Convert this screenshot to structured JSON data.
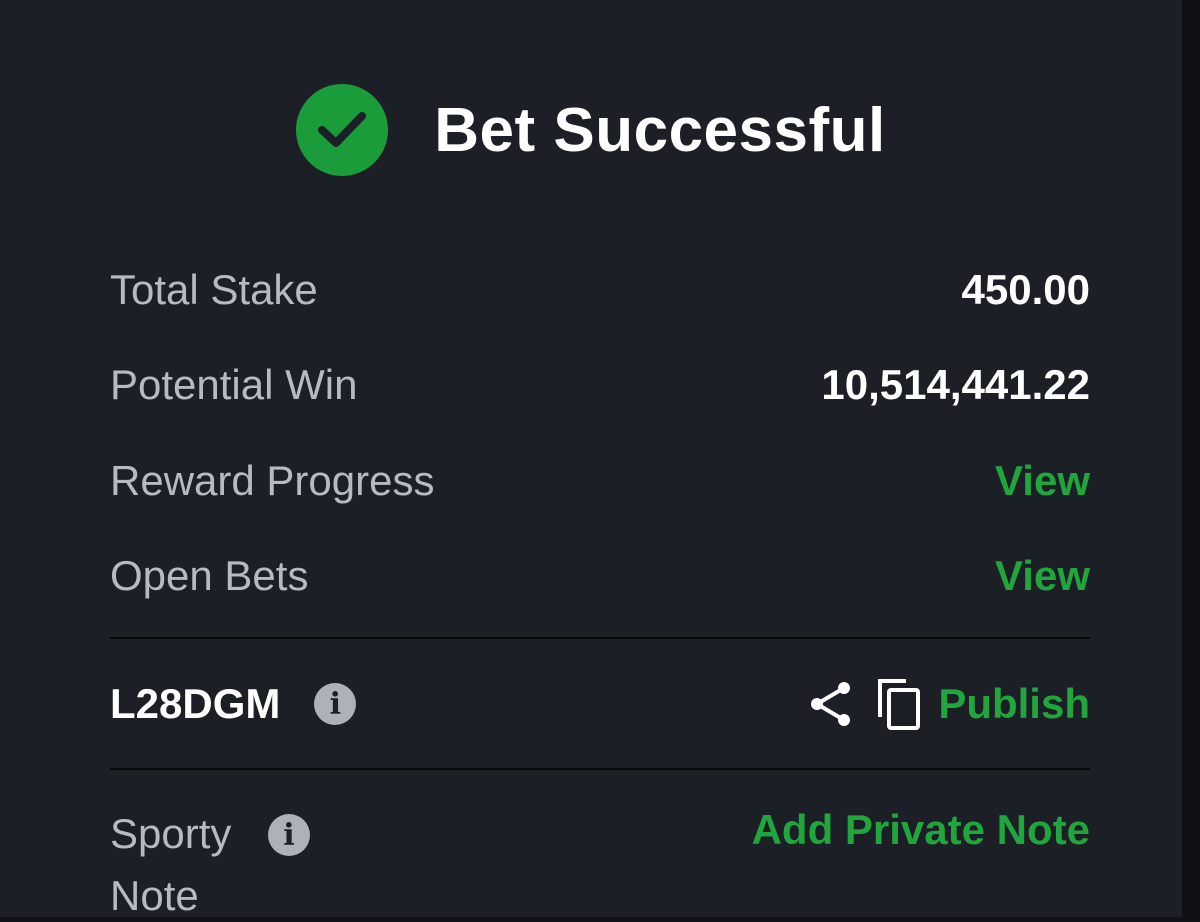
{
  "header": {
    "title": "Bet Successful",
    "icon": "check-circle-icon",
    "icon_color": "#1b9c3b"
  },
  "summary": {
    "total_stake_label": "Total Stake",
    "total_stake_value": "450.00",
    "potential_win_label": "Potential Win",
    "potential_win_value": "10,514,441.22",
    "reward_progress_label": "Reward Progress",
    "reward_progress_link": "View",
    "open_bets_label": "Open Bets",
    "open_bets_link": "View"
  },
  "booking": {
    "code": "L28DGM",
    "info_icon": "info-icon",
    "share_icon": "share-icon",
    "copy_icon": "copy-icon",
    "publish_label": "Publish"
  },
  "note": {
    "label_line1": "Sporty",
    "label_line2": "Note",
    "add_note_label": "Add Private Note"
  },
  "colors": {
    "accent": "#20a63c",
    "background": "#1c1f25"
  }
}
